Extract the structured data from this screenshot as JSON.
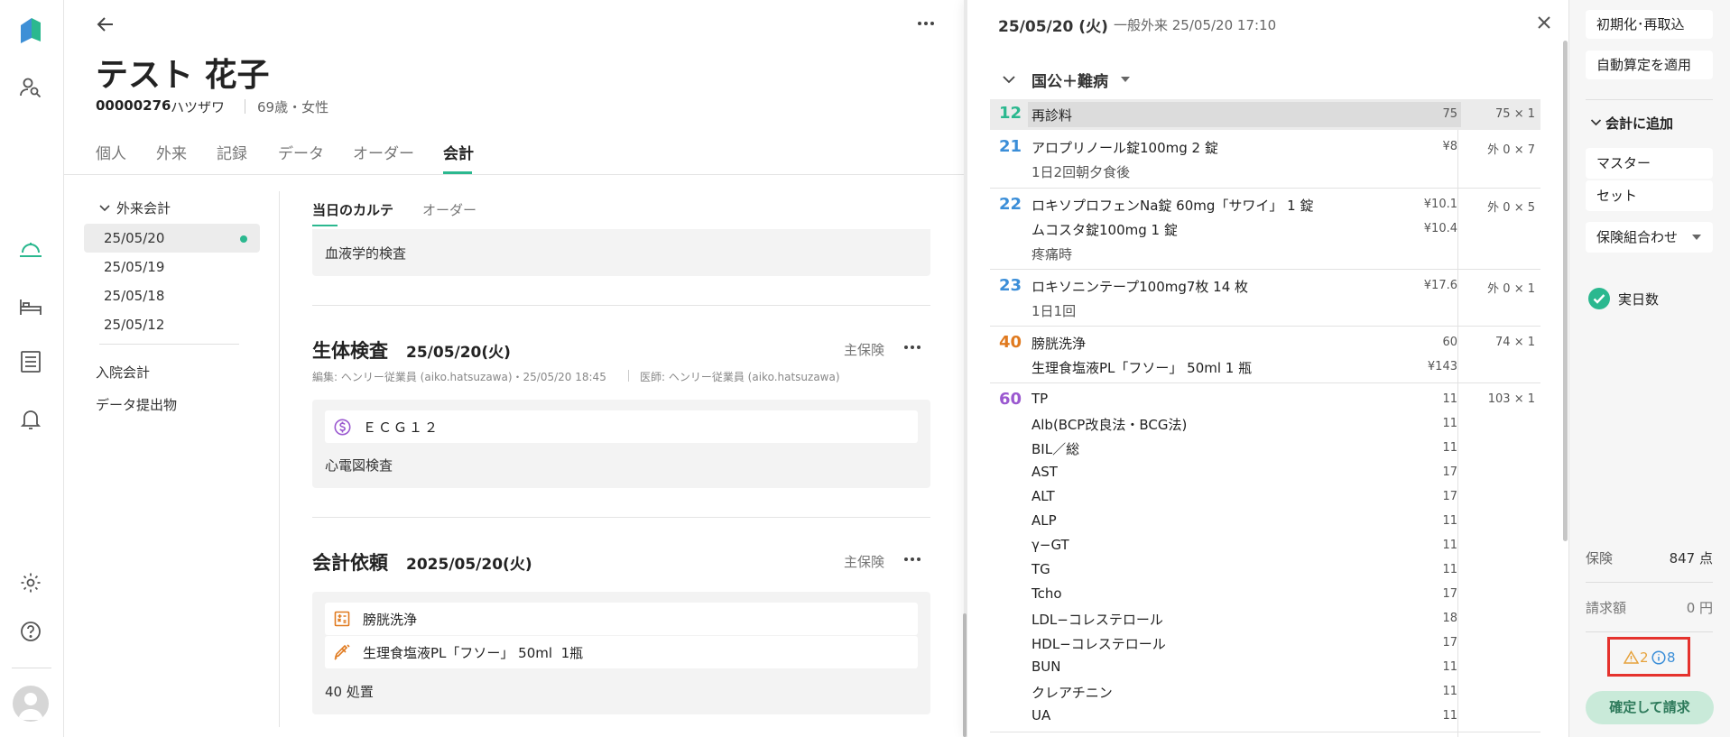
{
  "colors": {
    "accent": "#2bb88f",
    "warning": "#e6a23c",
    "info": "#3b8ed8",
    "highlight": "#e5322d"
  },
  "rail": {
    "icons": [
      "logo-icon",
      "patient-search-icon",
      "reception-icon",
      "bed-icon",
      "list-icon",
      "bell-icon",
      "gear-icon",
      "help-icon",
      "user-avatar-icon"
    ]
  },
  "patient": {
    "name": "テスト 花子",
    "id": "00000276",
    "kana": "ハツザワ",
    "age_sex": "69歳・女性"
  },
  "tabs": [
    "個人",
    "外来",
    "記録",
    "データ",
    "オーダー",
    "会計"
  ],
  "sub": {
    "group": "外来会計",
    "dates": [
      "25/05/20",
      "25/05/19",
      "25/05/18",
      "25/05/12"
    ],
    "inpatient": "入院会計",
    "submissions": "データ提出物"
  },
  "inner_tabs": [
    "当日のカルテ",
    "オーダー"
  ],
  "top_card": {
    "text": "血液学的検査"
  },
  "physio": {
    "title": "生体検査",
    "date": "25/05/20(火)",
    "insurance": "主保険",
    "meta": "編集: ヘンリー従業員 (aiko.hatsuzawa)・25/05/20 18:45",
    "doctor": "医師: ヘンリー従業員 (aiko.hatsuzawa)",
    "item": "ＥＣＧ１２",
    "note": "心電図検査"
  },
  "billing": {
    "title": "会計依頼",
    "date": "2025/05/20(火)",
    "insurance": "主保険",
    "items": [
      "膀胱洗浄",
      "生理食塩液PL「フソー」 50ml  1瓶"
    ],
    "note": "40 処置"
  },
  "drawer": {
    "date": "25/05/20 (火)",
    "visit": "一般外来 25/05/20 17:10",
    "group": "国公＋難病",
    "r12": {
      "num": "12",
      "name": "再診料",
      "price": "75",
      "qty": "75 × 1"
    },
    "r21": {
      "num": "21",
      "name": "アロプリノール錠100mg  2 錠",
      "price": "¥8",
      "qty": "外 0 × 7",
      "sub": "1日2回朝夕食後"
    },
    "r22": {
      "num": "22",
      "name": "ロキソプロフェンNa錠 60mg「サワイ」  1 錠",
      "price": "¥10.1",
      "qty": "外 0 × 5",
      "name2": "ムコスタ錠100mg  1 錠",
      "price2": "¥10.4",
      "sub": "疼痛時"
    },
    "r23": {
      "num": "23",
      "name": "ロキソニンテープ100mg7枚  14 枚",
      "price": "¥17.6",
      "qty": "外 0 × 1",
      "sub": "1日1回"
    },
    "r40": {
      "num": "40",
      "name": "膀胱洗浄",
      "price": "60",
      "qty": "74 × 1",
      "name2": "生理食塩液PL「フソー」 50ml  1 瓶",
      "price2": "¥143"
    },
    "r60": {
      "num": "60",
      "qty": "103 × 1",
      "items": [
        {
          "name": "TP",
          "price": "11"
        },
        {
          "name": "Alb(BCP改良法・BCG法)",
          "price": "11"
        },
        {
          "name": "BIL／総",
          "price": "11"
        },
        {
          "name": "AST",
          "price": "17"
        },
        {
          "name": "ALT",
          "price": "17"
        },
        {
          "name": "ALP",
          "price": "11"
        },
        {
          "name": "γ−GT",
          "price": "11"
        },
        {
          "name": "TG",
          "price": "11"
        },
        {
          "name": "Tcho",
          "price": "17"
        },
        {
          "name": "LDL−コレステロール",
          "price": "18"
        },
        {
          "name": "HDL−コレステロール",
          "price": "17"
        },
        {
          "name": "BUN",
          "price": "11"
        },
        {
          "name": "クレアチニン",
          "price": "11"
        },
        {
          "name": "UA",
          "price": "11"
        }
      ]
    }
  },
  "side": {
    "reset": "初期化･再取込",
    "auto": "自動算定を適用",
    "add": "会計に追加",
    "master": "マスター",
    "set": "セット",
    "combo": "保険組合わせ",
    "days": "実日数",
    "ins_label": "保険",
    "ins_value": "847 点",
    "bill_label": "請求額",
    "bill_value": "0 円",
    "warn": "2",
    "info": "8",
    "confirm": "確定して請求"
  }
}
